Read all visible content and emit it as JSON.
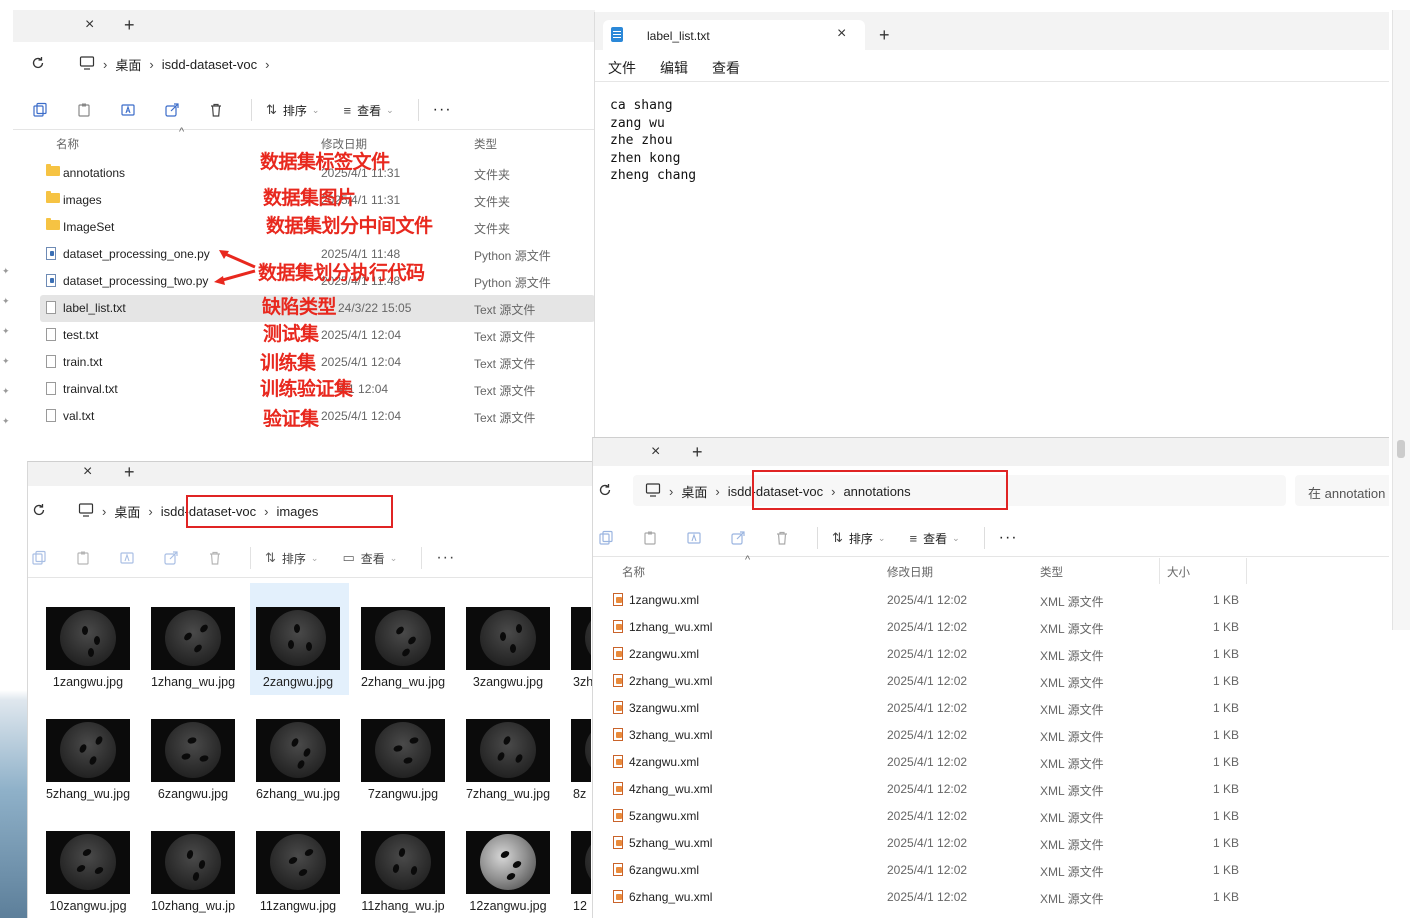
{
  "window_top": {
    "new_tab": "+",
    "close_tab": "×",
    "breadcrumb": [
      "桌面",
      "isdd-dataset-voc"
    ],
    "toolbar": {
      "sort": "排序",
      "view": "查看",
      "more": "···"
    },
    "columns": {
      "name": "名称",
      "date": "修改日期",
      "type": "类型"
    },
    "files": [
      {
        "name": "annotations",
        "date": "2025/4/1 11:31",
        "type": "文件夹",
        "icon": "folder-icon"
      },
      {
        "name": "images",
        "date": "2025/4/1 11:31",
        "type": "文件夹",
        "icon": "folder-icon"
      },
      {
        "name": "ImageSet",
        "date": "",
        "type": "文件夹",
        "icon": "folder-icon"
      },
      {
        "name": "dataset_processing_one.py",
        "date": "2025/4/1 11:48",
        "type": "Python 源文件",
        "icon": "python-file-icon"
      },
      {
        "name": "dataset_processing_two.py",
        "date": "2025/4/1 11:48",
        "type": "Python 源文件",
        "icon": "python-file-icon"
      },
      {
        "name": "label_list.txt",
        "date": "24/3/22 15:05",
        "type": "Text 源文件",
        "icon": "text-file-icon"
      },
      {
        "name": "test.txt",
        "date": "2025/4/1 12:04",
        "type": "Text 源文件",
        "icon": "text-file-icon"
      },
      {
        "name": "train.txt",
        "date": "2025/4/1 12:04",
        "type": "Text 源文件",
        "icon": "text-file-icon"
      },
      {
        "name": "trainval.txt",
        "date": "4/1 12:04",
        "type": "Text 源文件",
        "icon": "text-file-icon"
      },
      {
        "name": "val.txt",
        "date": "2025/4/1 12:04",
        "type": "Text 源文件",
        "icon": "text-file-icon"
      }
    ],
    "annotations": [
      "数据集标签文件",
      "数据集图片",
      "数据集划分中间文件",
      "数据集划分执行代码",
      "缺陷类型",
      "测试集",
      "训练集",
      "训练验证集",
      "验证集"
    ]
  },
  "notepad": {
    "tab_title": "label_list.txt",
    "close_tab": "×",
    "new_tab": "+",
    "menu": [
      "文件",
      "编辑",
      "查看"
    ],
    "lines": [
      "ca shang",
      "zang wu",
      "zhe zhou",
      "zhen kong",
      "zheng chang"
    ]
  },
  "window_images": {
    "new_tab": "+",
    "close_tab": "×",
    "breadcrumb": [
      "桌面",
      "isdd-dataset-voc",
      "images"
    ],
    "toolbar": {
      "sort": "排序",
      "view": "查看",
      "more": "···"
    },
    "row1": [
      "1zangwu.jpg",
      "1zhang_wu.jpg",
      "2zangwu.jpg",
      "2zhang_wu.jpg",
      "3zangwu.jpg",
      "3zh"
    ],
    "row2": [
      "5zhang_wu.jpg",
      "6zangwu.jpg",
      "6zhang_wu.jpg",
      "7zangwu.jpg",
      "7zhang_wu.jpg",
      "8z"
    ],
    "row3": [
      "10zangwu.jpg",
      "10zhang_wu.jp",
      "11zangwu.jpg",
      "11zhang_wu.jp",
      "12zangwu.jpg",
      "12"
    ]
  },
  "window_annotations": {
    "new_tab": "+",
    "close_tab": "×",
    "breadcrumb": [
      "桌面",
      "isdd-dataset-voc",
      "annotations"
    ],
    "search_placeholder": "在 annotation",
    "toolbar": {
      "sort": "排序",
      "view": "查看",
      "more": "···"
    },
    "columns": {
      "name": "名称",
      "date": "修改日期",
      "type": "类型",
      "size": "大小"
    },
    "files": [
      {
        "name": "1zangwu.xml",
        "date": "2025/4/1 12:02",
        "type": "XML 源文件",
        "size": "1 KB"
      },
      {
        "name": "1zhang_wu.xml",
        "date": "2025/4/1 12:02",
        "type": "XML 源文件",
        "size": "1 KB"
      },
      {
        "name": "2zangwu.xml",
        "date": "2025/4/1 12:02",
        "type": "XML 源文件",
        "size": "1 KB"
      },
      {
        "name": "2zhang_wu.xml",
        "date": "2025/4/1 12:02",
        "type": "XML 源文件",
        "size": "1 KB"
      },
      {
        "name": "3zangwu.xml",
        "date": "2025/4/1 12:02",
        "type": "XML 源文件",
        "size": "1 KB"
      },
      {
        "name": "3zhang_wu.xml",
        "date": "2025/4/1 12:02",
        "type": "XML 源文件",
        "size": "1 KB"
      },
      {
        "name": "4zangwu.xml",
        "date": "2025/4/1 12:02",
        "type": "XML 源文件",
        "size": "1 KB"
      },
      {
        "name": "4zhang_wu.xml",
        "date": "2025/4/1 12:02",
        "type": "XML 源文件",
        "size": "1 KB"
      },
      {
        "name": "5zangwu.xml",
        "date": "2025/4/1 12:02",
        "type": "XML 源文件",
        "size": "1 KB"
      },
      {
        "name": "5zhang_wu.xml",
        "date": "2025/4/1 12:02",
        "type": "XML 源文件",
        "size": "1 KB"
      },
      {
        "name": "6zangwu.xml",
        "date": "2025/4/1 12:02",
        "type": "XML 源文件",
        "size": "1 KB"
      },
      {
        "name": "6zhang_wu.xml",
        "date": "2025/4/1 12:02",
        "type": "XML 源文件",
        "size": "1 KB"
      }
    ]
  },
  "colors": {
    "annotation_red": "#e8281e",
    "selection": "#e5e5e5",
    "highlight_box": "#e02424"
  }
}
